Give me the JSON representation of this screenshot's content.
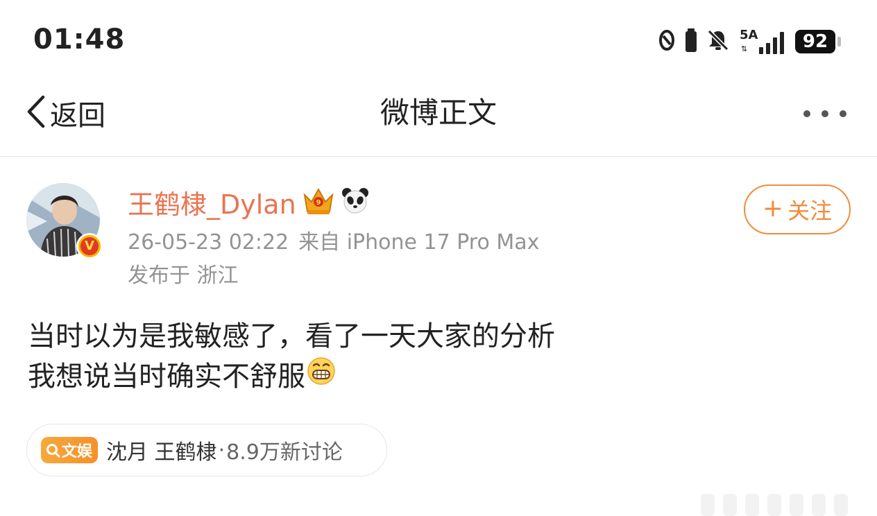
{
  "status_bar": {
    "time": "01:48",
    "network": "5A",
    "battery": "92",
    "icons": [
      "link-icon",
      "battery-saver-icon",
      "mute-bell-icon",
      "signal-icon"
    ]
  },
  "nav": {
    "back_label": "返回",
    "title": "微博正文",
    "more_icon": "more-dots-icon"
  },
  "post": {
    "username": "王鹤棣_Dylan",
    "badges": [
      "crown-icon",
      "panda-icon"
    ],
    "verified_badge": "V",
    "timestamp": "26-05-23 02:22",
    "source": "来自 iPhone 17 Pro Max",
    "location": "发布于 浙江",
    "text_lines": [
      "当时以为是我敏感了，看了一天大家的分析",
      "我想说当时确实不舒服"
    ],
    "emoji": "grinning-face-icon"
  },
  "follow_button": {
    "plus": "+",
    "label": "关注"
  },
  "topic": {
    "tag_label": "文娱",
    "name": "沈月 王鹤棣",
    "separator": "·",
    "count": "8.9万新讨论"
  },
  "colors": {
    "username": "#eb7350",
    "follow": "#f08c3a",
    "meta": "#939393",
    "tag": "#f5902a"
  }
}
